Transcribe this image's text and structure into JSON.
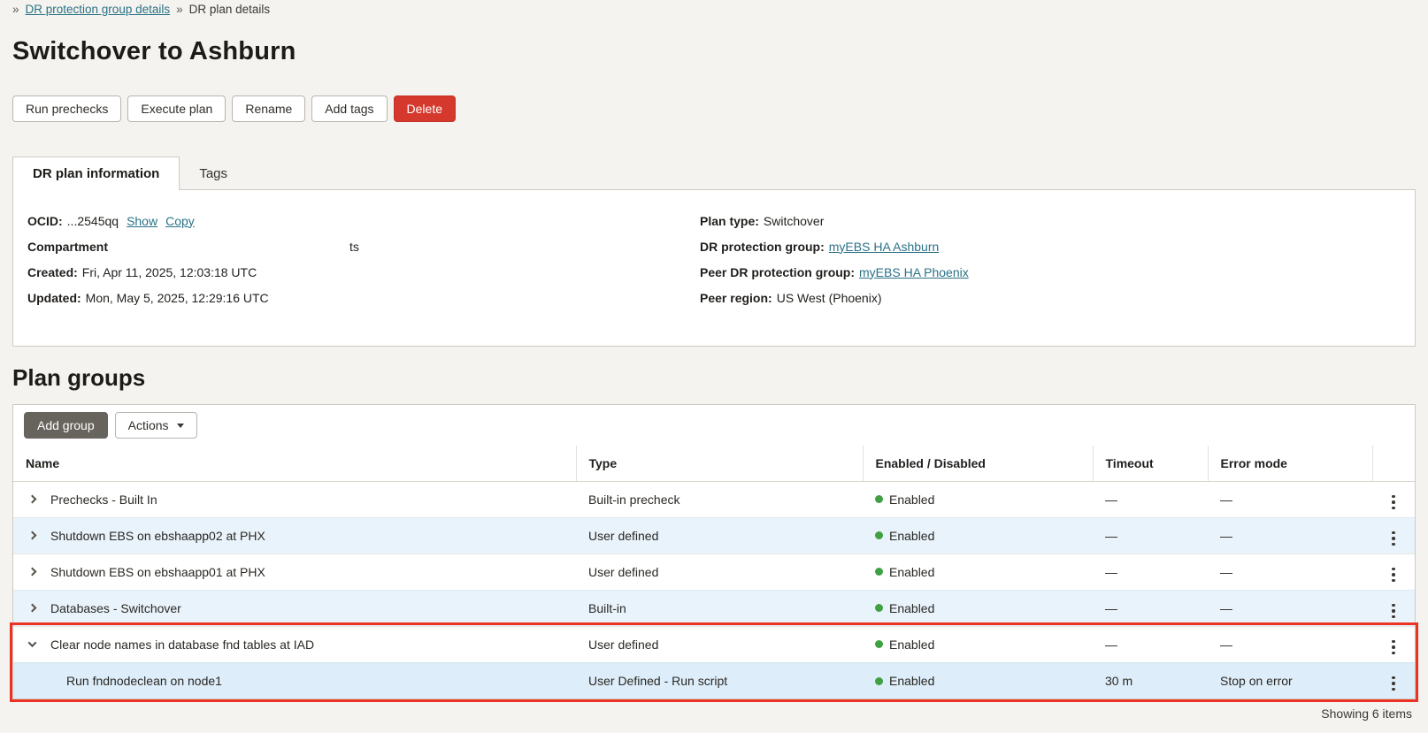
{
  "colors": {
    "link": "#2a7287",
    "danger_red": "#d5382c",
    "enabled_green": "#3fa142",
    "annotation_red": "#ec3323",
    "row_alt_blue": "#e9f3fb"
  },
  "breadcrumb": {
    "separator": "»",
    "link_label": "DR protection group details",
    "current_label": "DR plan details"
  },
  "page_title": "Switchover to Ashburn",
  "toolbar": {
    "run_prechecks": "Run prechecks",
    "execute_plan": "Execute plan",
    "rename": "Rename",
    "add_tags": "Add tags",
    "delete": "Delete"
  },
  "tabs": {
    "info": "DR plan information",
    "tags": "Tags"
  },
  "details": {
    "left": {
      "ocid_label": "OCID:",
      "ocid_value": "...2545qq",
      "show_link": "Show",
      "copy_link": "Copy",
      "compartment_label": "Compartment",
      "compartment_value": "ts",
      "created_label": "Created:",
      "created_value": "Fri, Apr 11, 2025, 12:03:18 UTC",
      "updated_label": "Updated:",
      "updated_value": "Mon, May 5, 2025, 12:29:16 UTC"
    },
    "right": {
      "plan_type_label": "Plan type:",
      "plan_type_value": "Switchover",
      "drpg_label": "DR protection group:",
      "drpg_value": "myEBS HA Ashburn",
      "peer_drpg_label": "Peer DR protection group:",
      "peer_drpg_value": "myEBS HA Phoenix",
      "peer_region_label": "Peer region:",
      "peer_region_value": "US West (Phoenix)"
    }
  },
  "plan_groups": {
    "section_title": "Plan groups",
    "add_group_button": "Add group",
    "actions_button": "Actions",
    "columns": {
      "name": "Name",
      "type": "Type",
      "status": "Enabled / Disabled",
      "timeout": "Timeout",
      "error_mode": "Error mode"
    },
    "rows": [
      {
        "name": "Prechecks - Built In",
        "type": "Built-in precheck",
        "status": "Enabled",
        "timeout": "—",
        "error_mode": "—"
      },
      {
        "name": "Shutdown EBS on ebshaapp02 at PHX",
        "type": "User defined",
        "status": "Enabled",
        "timeout": "—",
        "error_mode": "—"
      },
      {
        "name": "Shutdown EBS on ebshaapp01 at PHX",
        "type": "User defined",
        "status": "Enabled",
        "timeout": "—",
        "error_mode": "—"
      },
      {
        "name": "Databases - Switchover",
        "type": "Built-in",
        "status": "Enabled",
        "timeout": "—",
        "error_mode": "—"
      },
      {
        "name": "Clear node names in database fnd tables at IAD",
        "type": "User defined",
        "status": "Enabled",
        "timeout": "—",
        "error_mode": "—"
      },
      {
        "name": "Run fndnodeclean on node1",
        "type": "User Defined - Run script",
        "status": "Enabled",
        "timeout": "30 m",
        "error_mode": "Stop on error"
      }
    ],
    "footer": "Showing 6 items"
  }
}
